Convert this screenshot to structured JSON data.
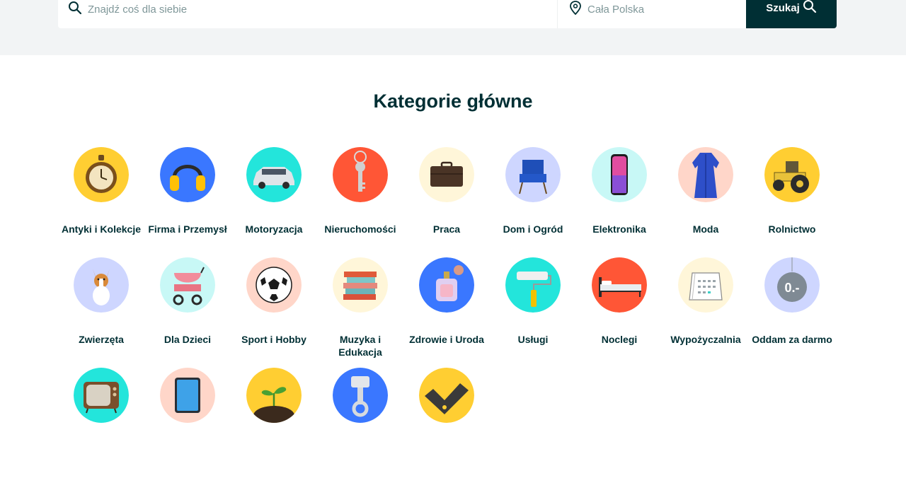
{
  "search": {
    "query_placeholder": "Znajdź coś dla siebie",
    "location_placeholder": "Cała Polska",
    "button_label": "Szukaj"
  },
  "main": {
    "title": "Kategorie główne",
    "categories": [
      {
        "label": "Antyki i Kolekcje",
        "icon": "pocket-watch-icon",
        "bg": "#ffce32"
      },
      {
        "label": "Firma i Przemysł",
        "icon": "headphones-icon",
        "bg": "#3a77ff"
      },
      {
        "label": "Motoryzacja",
        "icon": "car-icon",
        "bg": "#23e5db"
      },
      {
        "label": "Nieruchomości",
        "icon": "key-icon",
        "bg": "#ff5636"
      },
      {
        "label": "Praca",
        "icon": "briefcase-icon",
        "bg": "#fff6d9"
      },
      {
        "label": "Dom i Ogród",
        "icon": "armchair-icon",
        "bg": "#ced6ff"
      },
      {
        "label": "Elektronika",
        "icon": "smartphone-icon",
        "bg": "#c8f8f6"
      },
      {
        "label": "Moda",
        "icon": "dress-icon",
        "bg": "#ffd6c9"
      },
      {
        "label": "Rolnictwo",
        "icon": "tractor-icon",
        "bg": "#ffce32"
      },
      {
        "label": "Zwierzęta",
        "icon": "dog-icon",
        "bg": "#ced6ff"
      },
      {
        "label": "Dla Dzieci",
        "icon": "stroller-icon",
        "bg": "#c8f8f6"
      },
      {
        "label": "Sport i Hobby",
        "icon": "football-icon",
        "bg": "#ffd6c9"
      },
      {
        "label": "Muzyka i Edukacja",
        "icon": "books-icon",
        "bg": "#fff6d9"
      },
      {
        "label": "Zdrowie i Uroda",
        "icon": "perfume-icon",
        "bg": "#3a77ff"
      },
      {
        "label": "Usługi",
        "icon": "paint-roller-icon",
        "bg": "#23e5db"
      },
      {
        "label": "Noclegi",
        "icon": "bed-icon",
        "bg": "#ff5636"
      },
      {
        "label": "Wypożyczalnia",
        "icon": "calendar-icon",
        "bg": "#fff6d9"
      },
      {
        "label": "Oddam za darmo",
        "icon": "price-tag-icon",
        "bg": "#ced6ff",
        "tag_text": "0.-"
      },
      {
        "label": "",
        "icon": "tv-icon",
        "bg": "#23e5db"
      },
      {
        "label": "",
        "icon": "tablet-icon",
        "bg": "#ffd6c9"
      },
      {
        "label": "",
        "icon": "plant-icon",
        "bg": "#ffce32"
      },
      {
        "label": "",
        "icon": "piston-icon",
        "bg": "#3a77ff"
      },
      {
        "label": "",
        "icon": "checkmark-icon",
        "bg": "#ffce32"
      }
    ]
  }
}
